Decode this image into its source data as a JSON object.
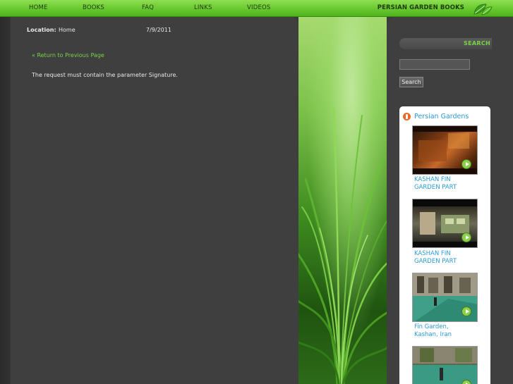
{
  "nav": {
    "items": [
      "HOME",
      "BOOKS",
      "FAQ",
      "LINKS",
      "VIDEOS"
    ],
    "brand": "PERSIAN GARDEN BOOKS"
  },
  "content": {
    "location_label": "Location:",
    "location_value": "Home",
    "date": "7/9/2011",
    "return_link": "« Return to Previous Page",
    "message": "The request must contain the parameter Signature."
  },
  "sidebar": {
    "search_title": "SEARCH",
    "search_value": "",
    "search_button": "Search",
    "videos_title": "Persian Gardens",
    "videos": [
      {
        "caption_line1": "KASHAN FIN",
        "caption_line2": "GARDEN PART"
      },
      {
        "caption_line1": "KASHAN FIN",
        "caption_line2": "GARDEN PART"
      },
      {
        "caption_line1": "Fin Garden,",
        "caption_line2": "Kashan, Iran"
      },
      {
        "caption_line1": "",
        "caption_line2": ""
      }
    ]
  },
  "colors": {
    "nav_green": "#6fcc34",
    "link_green": "#79d24a",
    "video_link_blue": "#2a9bd6",
    "panel_dark": "#3f3f3f"
  }
}
